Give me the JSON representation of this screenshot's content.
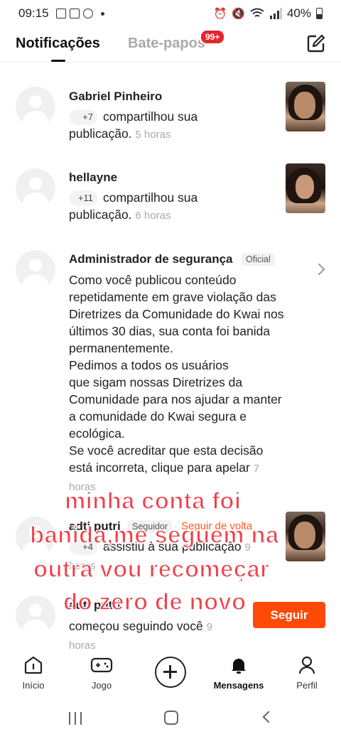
{
  "status_bar": {
    "time": "09:15",
    "battery": "40%"
  },
  "header": {
    "tab_notifications": "Notificações",
    "tab_chats": "Bate-papos",
    "chats_badge": "99+"
  },
  "notifications": [
    {
      "name": "Gabriel Pinheiro",
      "count": "+7",
      "action_line1": "compartilhou sua",
      "action_line2": "publicação.",
      "time": "5 horas"
    },
    {
      "name": "hellayne",
      "count": "+11",
      "action_line1": "compartilhou sua",
      "action_line2": "publicação.",
      "time": "6 horas"
    },
    {
      "name": "Administrador de segurança",
      "badge": "Oficial",
      "lines": [
        "Como você publicou conteúdo",
        "repetidamente em grave violação das",
        "Diretrizes da Comunidade do Kwai nos",
        "últimos 30 dias, sua conta foi banida",
        "permanentemente.",
        "Pedimos a todos os usuários",
        "que sigam nossas Diretrizes da",
        "Comunidade para nos ajudar a manter",
        "a comunidade do Kwai segura e",
        "ecológica.",
        "Se você acreditar que esta decisão",
        "está incorreta, clique para apelar"
      ],
      "time_part1": "7",
      "time_part2": "horas"
    },
    {
      "name": "adti putri",
      "badge": "Seguidor",
      "follow_back": "Seguir de volta",
      "count": "+4",
      "action": "assistiu à sua publicação",
      "time_part1": "9",
      "time_part2": "horas"
    },
    {
      "name": "adti putri",
      "action": "começou seguindo você",
      "time_part1": "9",
      "time_part2": "horas",
      "button": "Seguir"
    }
  ],
  "overlay": {
    "line1": "minha conta foi",
    "line2": "banida,me seguem na",
    "line3": "outra  vou recomeçar",
    "line4": "do zero de novo"
  },
  "bottom_nav": {
    "home": "Início",
    "game": "Jogo",
    "messages": "Mensagens",
    "profile": "Perfil"
  }
}
